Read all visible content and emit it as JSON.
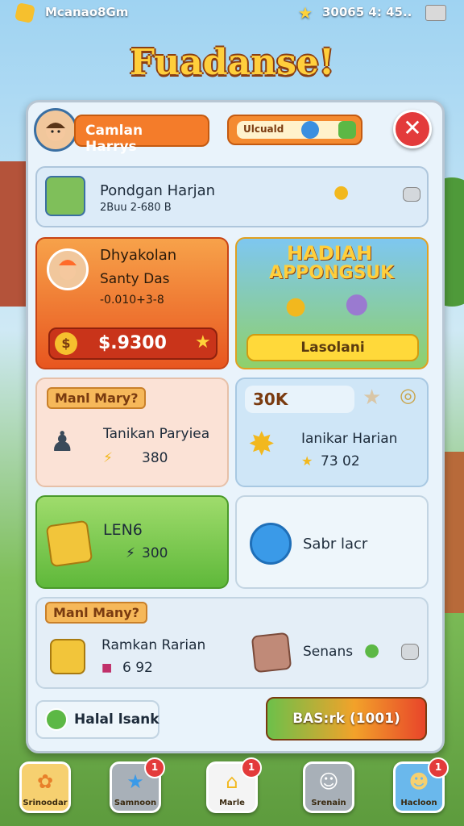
{
  "status_bar": {
    "app_name": "Mcanao8Gm",
    "score": "30065 4: 45.."
  },
  "title": "Fuadanse!",
  "profile": {
    "name": "Camlan Harrys",
    "search_value": "Ulcuald"
  },
  "player_row": {
    "name": "Pondgan Harjan",
    "detail": "2Buu 2-680 B"
  },
  "daily_card": {
    "line1": "Dhyakolan",
    "line2": "Santy Das",
    "line3": "-0.010+3-8",
    "amount": "$.9300"
  },
  "reward_card": {
    "title_line1": "HADIAH",
    "title_line2": "APPONGSUK",
    "button_label": "Lasolani"
  },
  "task_left": {
    "tag": "Manl Mary?",
    "title": "Tanikan Paryiea",
    "value": "380"
  },
  "task_right": {
    "tag": "30K",
    "title": "Ianikar Harian",
    "value": "73 02"
  },
  "green_card": {
    "title": "LEN6",
    "value": "300"
  },
  "blue_card": {
    "title": "Sabr lacr"
  },
  "bottom_section": {
    "tag": "Manl Many?",
    "title": "Ramkan Rarian",
    "value": "6 92",
    "right_label": "Senans"
  },
  "footer": {
    "left_button": "Halal lsank",
    "right_button": "BAS:rk (1001)"
  },
  "nav": [
    {
      "label": "Srinoodar",
      "badge": ""
    },
    {
      "label": "Samnoon",
      "badge": "1"
    },
    {
      "label": "Marle",
      "badge": "1"
    },
    {
      "label": "Srenain",
      "badge": ""
    },
    {
      "label": "Hacloon",
      "badge": "1"
    }
  ],
  "colors": {
    "accent": "#f47c2a",
    "gold": "#ffcf3c",
    "danger": "#e33b3b",
    "green": "#6cc04a"
  }
}
